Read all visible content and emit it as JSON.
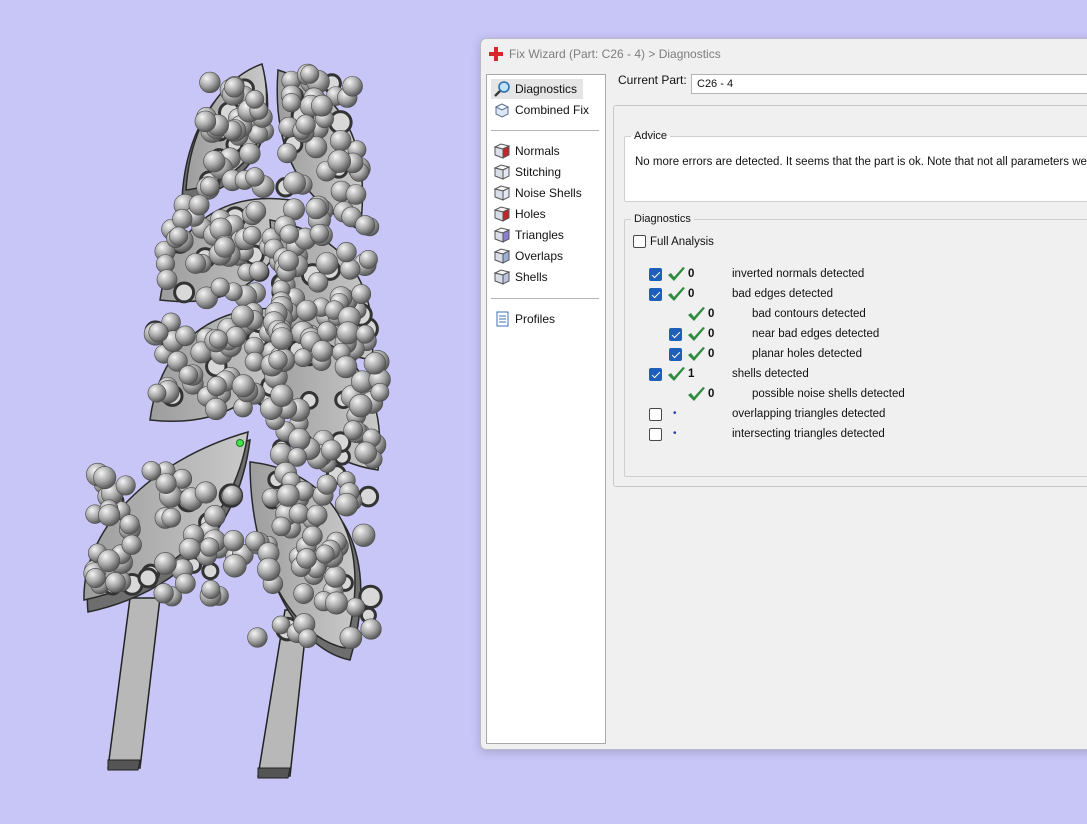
{
  "window": {
    "title": "Fix Wizard (Part: C26 - 4) > Diagnostics"
  },
  "nav": {
    "items": [
      {
        "label": "Diagnostics",
        "icon": "magnifier-icon",
        "selected": true
      },
      {
        "label": "Combined Fix",
        "icon": "combined-fix-icon"
      },
      {
        "label": "Normals",
        "icon": "normals-cube-icon"
      },
      {
        "label": "Stitching",
        "icon": "stitching-cube-icon"
      },
      {
        "label": "Noise Shells",
        "icon": "noise-shells-cube-icon"
      },
      {
        "label": "Holes",
        "icon": "holes-cube-icon"
      },
      {
        "label": "Triangles",
        "icon": "triangles-cube-icon"
      },
      {
        "label": "Overlaps",
        "icon": "overlaps-cube-icon"
      },
      {
        "label": "Shells",
        "icon": "shells-cube-icon"
      },
      {
        "label": "Profiles",
        "icon": "document-icon"
      }
    ]
  },
  "current_part": {
    "label": "Current Part:",
    "value": "C26 - 4"
  },
  "advice": {
    "title": "Advice",
    "text": "No more errors are detected. It seems that the part is ok. Note that not all parameters were a"
  },
  "diagnostics": {
    "title": "Diagnostics",
    "full_analysis": {
      "label": "Full Analysis",
      "checked": false
    },
    "rows": [
      {
        "label": "inverted normals detected",
        "count": "0",
        "checkbox": true,
        "checked": true,
        "status": "ok",
        "indent": 0
      },
      {
        "label": "bad edges detected",
        "count": "0",
        "checkbox": true,
        "checked": true,
        "status": "ok",
        "indent": 0
      },
      {
        "label": "bad contours detected",
        "count": "0",
        "checkbox": false,
        "status": "ok",
        "indent": 1
      },
      {
        "label": "near bad edges detected",
        "count": "0",
        "checkbox": true,
        "checked": true,
        "status": "ok",
        "indent": 1
      },
      {
        "label": "planar holes detected",
        "count": "0",
        "checkbox": true,
        "checked": true,
        "status": "ok",
        "indent": 1
      },
      {
        "label": "shells detected",
        "count": "1",
        "checkbox": true,
        "checked": true,
        "status": "ok",
        "indent": 0
      },
      {
        "label": "possible noise shells detected",
        "count": "0",
        "checkbox": false,
        "status": "ok",
        "indent": 1
      },
      {
        "label": "overlapping triangles detected",
        "count": "",
        "checkbox": true,
        "checked": false,
        "status": "dot",
        "indent": 0
      },
      {
        "label": "intersecting triangles detected",
        "count": "",
        "checkbox": true,
        "checked": false,
        "status": "dot",
        "indent": 0
      }
    ]
  },
  "colors": {
    "background": "#c8c6f7",
    "check_green": "#2e8b3e",
    "checkbox_blue": "#1f5fba",
    "app_red": "#d8262a"
  }
}
